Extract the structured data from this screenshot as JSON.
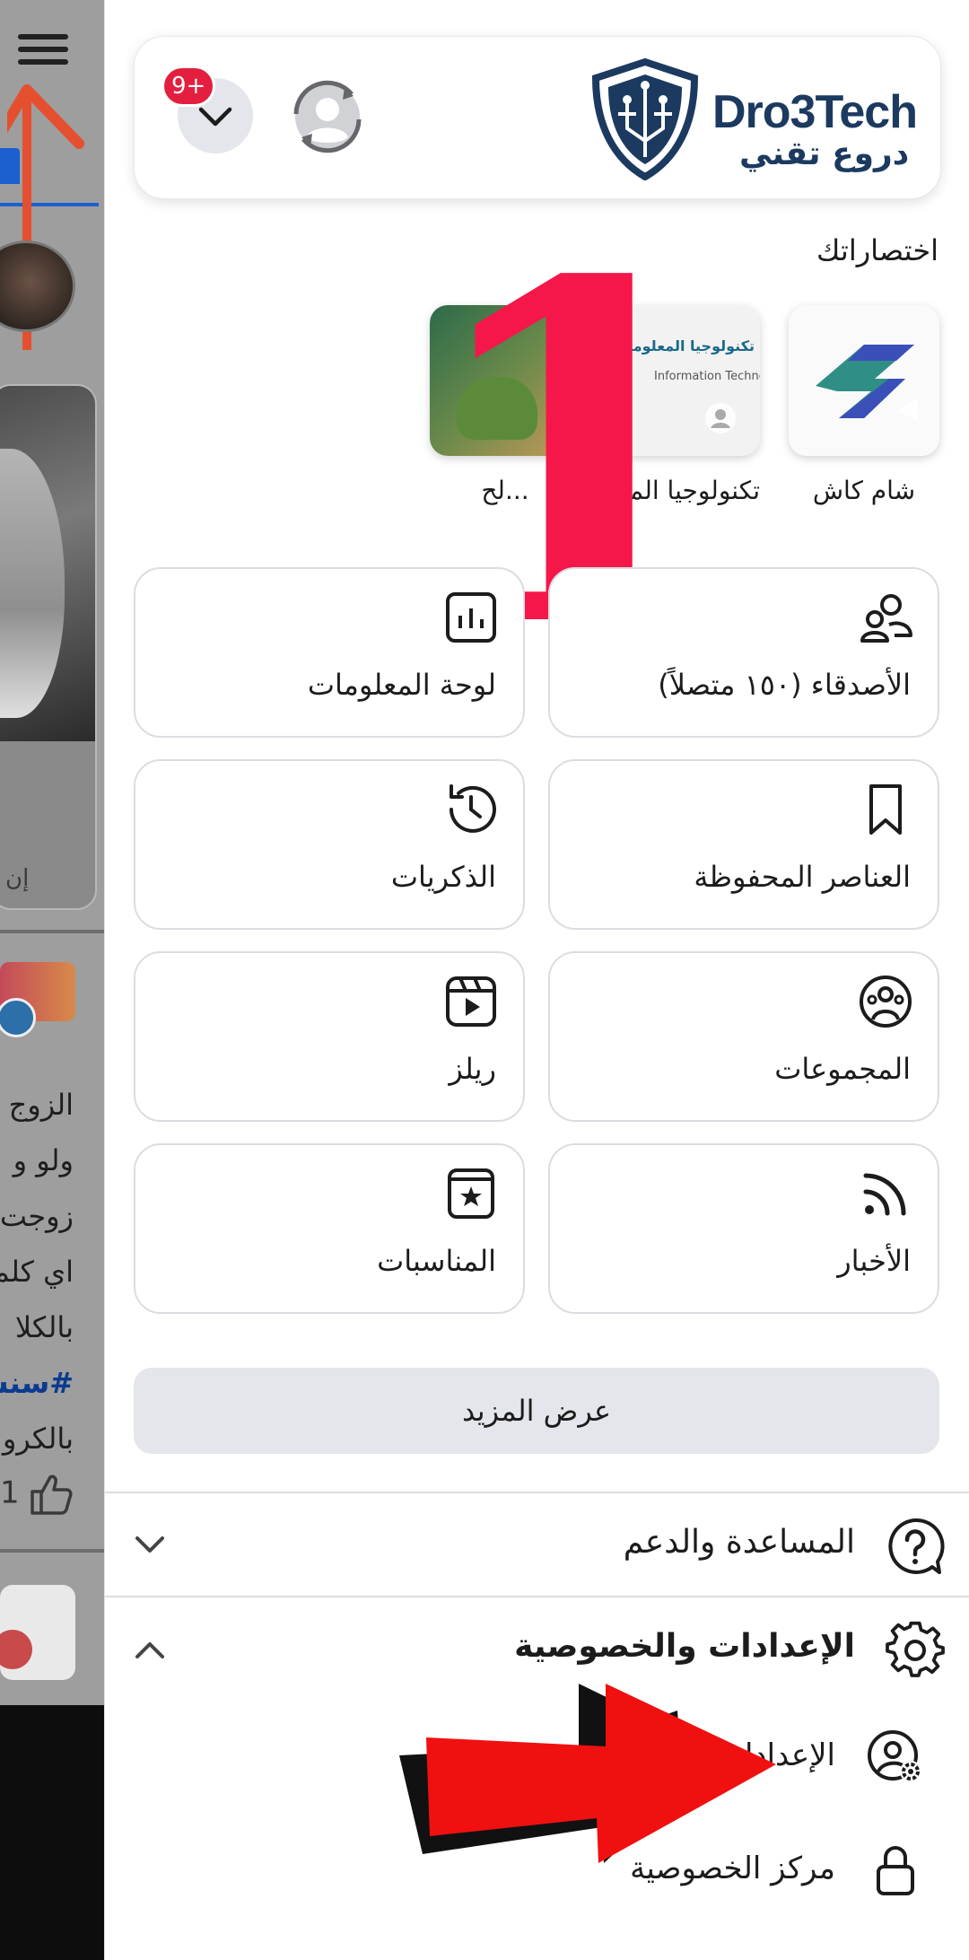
{
  "feed": {
    "story_label": "إن",
    "post_lines": [
      "الزوج",
      "ولو و",
      "زوجت",
      "اي كلم",
      "بالكلا",
      "#سنش",
      "بالكرو"
    ],
    "like_count": "1"
  },
  "header": {
    "notification_badge": "9+",
    "logo_en": "Dro3Tech",
    "logo_ar": "دروع تقني"
  },
  "shortcuts": {
    "title": "اختصاراتك",
    "items": [
      {
        "label": "شام كاش"
      },
      {
        "label": "تكنولوجيا الم...",
        "thumb_title": "تكنولوجيا المعلومات",
        "thumb_sub": "Information Technolo"
      },
      {
        "label": "...لح"
      }
    ]
  },
  "overlay_number": "1",
  "tiles": {
    "friends": "الأصدقاء (١٥٠ متصلاً)",
    "dashboard": "لوحة المعلومات",
    "saved": "العناصر المحفوظة",
    "memories": "الذكريات",
    "groups": "المجموعات",
    "reels": "ريلز",
    "feeds": "الأخبار",
    "events": "المناسبات"
  },
  "see_more": "عرض المزيد",
  "sections": {
    "help": "المساعدة والدعم",
    "settings_privacy": "الإعدادات والخصوصية",
    "settings": "الإعدادات",
    "privacy_center": "مركز الخصوصية"
  },
  "colors": {
    "badge": "#e41e3f",
    "overlay_number": "#f5174a",
    "arrow": "#f01010",
    "brand": "#1c3a60"
  }
}
